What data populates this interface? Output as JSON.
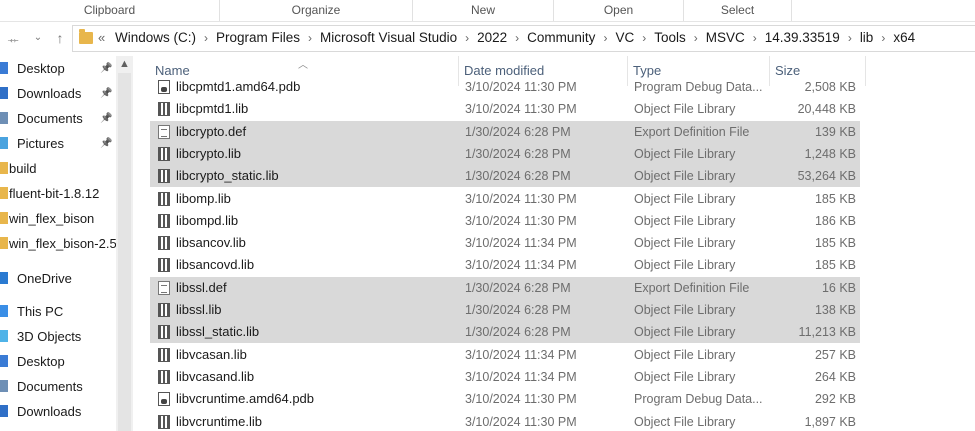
{
  "ribbon": {
    "groups": [
      "Clipboard",
      "Organize",
      "New",
      "Open",
      "Select"
    ]
  },
  "nav": {
    "back_icon": "back-arrow-icon",
    "forward_icon": "forward-arrow-icon",
    "recent_icon": "chevron-down-icon",
    "up_icon": "up-arrow-icon"
  },
  "address": {
    "overflow": "«",
    "crumbs": [
      "Windows (C:)",
      "Program Files",
      "Microsoft Visual Studio",
      "2022",
      "Community",
      "VC",
      "Tools",
      "MSVC",
      "14.39.33519",
      "lib",
      "x64"
    ]
  },
  "navpane": {
    "items": [
      {
        "label": "Desktop",
        "icon": "desktop-icon",
        "pinned": true
      },
      {
        "label": "Downloads",
        "icon": "download-icon",
        "pinned": true
      },
      {
        "label": "Documents",
        "icon": "document-icon",
        "pinned": true
      },
      {
        "label": "Pictures",
        "icon": "pictures-icon",
        "pinned": true
      },
      {
        "label": "build",
        "icon": "folder-icon",
        "pinned": false
      },
      {
        "label": "fluent-bit-1.8.12",
        "icon": "folder-icon",
        "pinned": false
      },
      {
        "label": "win_flex_bison",
        "icon": "folder-icon",
        "pinned": false
      },
      {
        "label": "win_flex_bison-2.5",
        "icon": "folder-icon",
        "pinned": false
      },
      {
        "label": "OneDrive",
        "icon": "cloud-icon",
        "pinned": false
      },
      {
        "label": "This PC",
        "icon": "computer-icon",
        "pinned": false
      },
      {
        "label": "3D Objects",
        "icon": "cube-icon",
        "pinned": false
      },
      {
        "label": "Desktop",
        "icon": "desktop-icon",
        "pinned": false
      },
      {
        "label": "Documents",
        "icon": "document-icon",
        "pinned": false
      },
      {
        "label": "Downloads",
        "icon": "download-icon",
        "pinned": false
      }
    ]
  },
  "columns": {
    "name": "Name",
    "date": "Date modified",
    "type": "Type",
    "size": "Size"
  },
  "files": [
    {
      "name": "libcpmtd1.amd64.pdb",
      "date": "3/10/2024 11:30 PM",
      "type": "Program Debug Data...",
      "size": "2,508 KB",
      "icon": "pdb",
      "selected": false
    },
    {
      "name": "libcpmtd1.lib",
      "date": "3/10/2024 11:30 PM",
      "type": "Object File Library",
      "size": "20,448 KB",
      "icon": "lib",
      "selected": false
    },
    {
      "name": "libcrypto.def",
      "date": "1/30/2024 6:28 PM",
      "type": "Export Definition File",
      "size": "139 KB",
      "icon": "def",
      "selected": true
    },
    {
      "name": "libcrypto.lib",
      "date": "1/30/2024 6:28 PM",
      "type": "Object File Library",
      "size": "1,248 KB",
      "icon": "lib",
      "selected": true
    },
    {
      "name": "libcrypto_static.lib",
      "date": "1/30/2024 6:28 PM",
      "type": "Object File Library",
      "size": "53,264 KB",
      "icon": "lib",
      "selected": true
    },
    {
      "name": "libomp.lib",
      "date": "3/10/2024 11:30 PM",
      "type": "Object File Library",
      "size": "185 KB",
      "icon": "lib",
      "selected": false
    },
    {
      "name": "libompd.lib",
      "date": "3/10/2024 11:30 PM",
      "type": "Object File Library",
      "size": "186 KB",
      "icon": "lib",
      "selected": false
    },
    {
      "name": "libsancov.lib",
      "date": "3/10/2024 11:34 PM",
      "type": "Object File Library",
      "size": "185 KB",
      "icon": "lib",
      "selected": false
    },
    {
      "name": "libsancovd.lib",
      "date": "3/10/2024 11:34 PM",
      "type": "Object File Library",
      "size": "185 KB",
      "icon": "lib",
      "selected": false
    },
    {
      "name": "libssl.def",
      "date": "1/30/2024 6:28 PM",
      "type": "Export Definition File",
      "size": "16 KB",
      "icon": "def",
      "selected": true
    },
    {
      "name": "libssl.lib",
      "date": "1/30/2024 6:28 PM",
      "type": "Object File Library",
      "size": "138 KB",
      "icon": "lib",
      "selected": true
    },
    {
      "name": "libssl_static.lib",
      "date": "1/30/2024 6:28 PM",
      "type": "Object File Library",
      "size": "11,213 KB",
      "icon": "lib",
      "selected": true
    },
    {
      "name": "libvcasan.lib",
      "date": "3/10/2024 11:34 PM",
      "type": "Object File Library",
      "size": "257 KB",
      "icon": "lib",
      "selected": false
    },
    {
      "name": "libvcasand.lib",
      "date": "3/10/2024 11:34 PM",
      "type": "Object File Library",
      "size": "264 KB",
      "icon": "lib",
      "selected": false
    },
    {
      "name": "libvcruntime.amd64.pdb",
      "date": "3/10/2024 11:30 PM",
      "type": "Program Debug Data...",
      "size": "292 KB",
      "icon": "pdb",
      "selected": false
    },
    {
      "name": "libvcruntime.lib",
      "date": "3/10/2024 11:30 PM",
      "type": "Object File Library",
      "size": "1,897 KB",
      "icon": "lib",
      "selected": false
    }
  ]
}
